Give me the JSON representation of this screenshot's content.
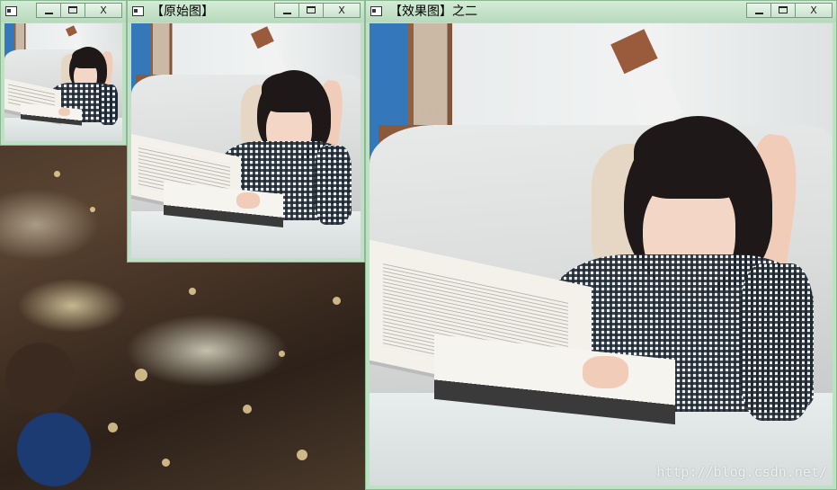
{
  "windows": {
    "small": {
      "title": "",
      "buttons": {
        "minimize_icon": "minimize-icon",
        "maximize_icon": "maximize-icon",
        "close_label": "X"
      }
    },
    "original": {
      "title": "【原始图】",
      "buttons": {
        "minimize_icon": "minimize-icon",
        "maximize_icon": "maximize-icon",
        "close_label": "X"
      }
    },
    "effect": {
      "title": "【效果图】之二",
      "buttons": {
        "minimize_icon": "minimize-icon",
        "maximize_icon": "maximize-icon",
        "close_label": "X"
      }
    }
  },
  "watermark": "http://blog.csdn.net/",
  "colors": {
    "titlebar": "#bfe0c4",
    "window_border": "#8db894"
  }
}
